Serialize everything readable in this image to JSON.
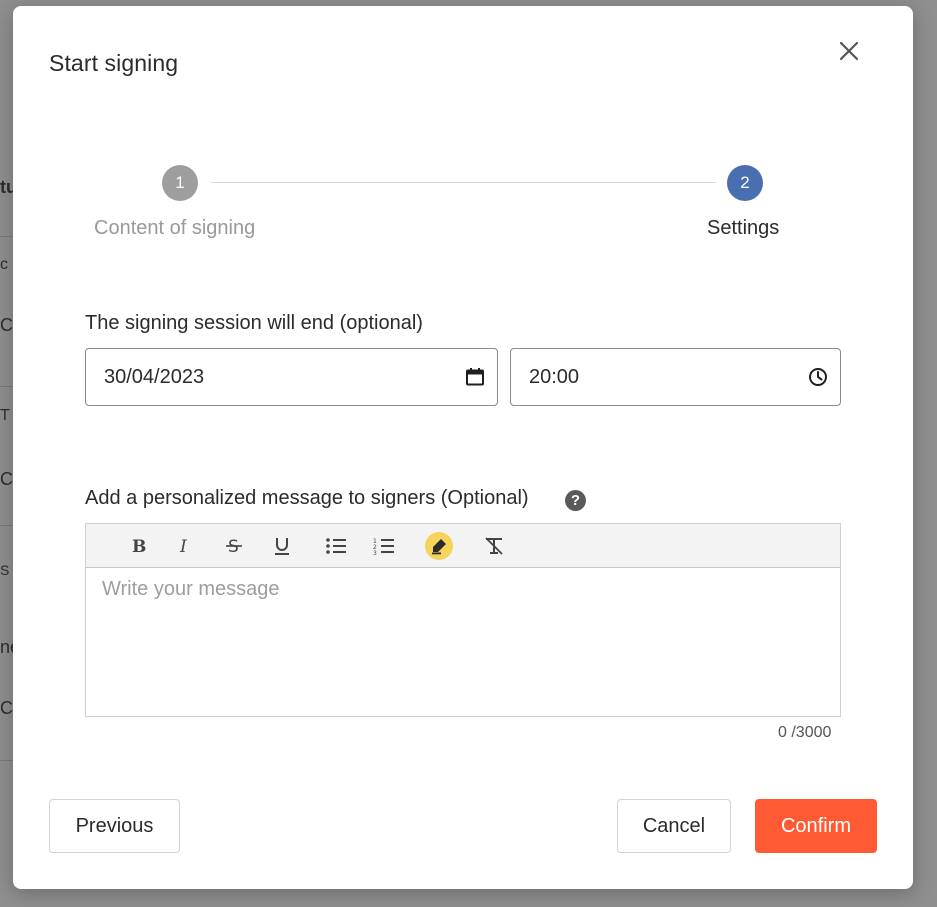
{
  "background": {
    "fragments": [
      "tu",
      "c",
      "C",
      "T",
      "C",
      "S",
      "ne",
      "C"
    ]
  },
  "modal": {
    "title": "Start signing"
  },
  "stepper": {
    "steps": [
      {
        "number": "1",
        "label": "Content of signing",
        "state": "completed"
      },
      {
        "number": "2",
        "label": "Settings",
        "state": "active"
      }
    ],
    "colors": {
      "completed": "#9e9e9e",
      "active": "#4a6fb0"
    }
  },
  "end_session": {
    "label": "The signing session will end (optional)",
    "date_value": "30/04/2023",
    "time_value": "20:00",
    "date_icon": "calendar-icon",
    "time_icon": "clock-icon"
  },
  "message": {
    "label": "Add a personalized message to signers (Optional)",
    "help_icon": "help-icon",
    "placeholder": "Write your message",
    "counter": "0 /3000",
    "toolbar": [
      "bold-icon",
      "italic-icon",
      "strikethrough-icon",
      "underline-icon",
      "bullet-list-icon",
      "numbered-list-icon",
      "highlight-icon",
      "clear-format-icon"
    ]
  },
  "footer": {
    "previous_label": "Previous",
    "cancel_label": "Cancel",
    "confirm_label": "Confirm",
    "accent_color": "#ff5a34"
  }
}
